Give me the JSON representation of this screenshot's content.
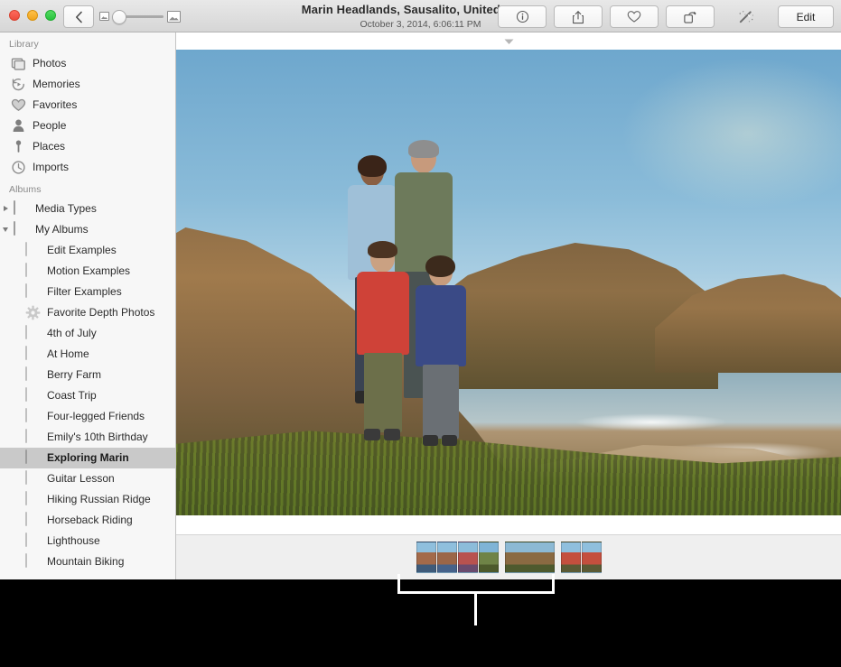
{
  "window": {
    "title": "Marin Headlands, Sausalito, United States",
    "subtitle": "October 3, 2014, 6:06:11 PM"
  },
  "traffic_lights": {
    "close_label": "Close",
    "minimize_label": "Minimize",
    "zoom_label": "Zoom",
    "close_color": "#ec4b3c",
    "minimize_color": "#f0a41c",
    "zoom_color": "#27c33c"
  },
  "toolbar": {
    "back_label": "Back",
    "zoom_slider": {
      "min_icon": "small-photo-icon",
      "max_icon": "large-photo-icon",
      "value": 0
    },
    "buttons": [
      {
        "name": "info-button",
        "icon": "info-icon",
        "label": ""
      },
      {
        "name": "share-button",
        "icon": "share-icon",
        "label": ""
      },
      {
        "name": "favorite-button",
        "icon": "heart-icon",
        "label": ""
      },
      {
        "name": "rotate-button",
        "icon": "rotate-icon",
        "label": ""
      },
      {
        "name": "auto-enhance-button",
        "icon": "magic-wand-icon",
        "label": ""
      }
    ],
    "edit_label": "Edit"
  },
  "sidebar": {
    "sections": [
      {
        "header": "Library",
        "items": [
          {
            "label": "Photos",
            "icon": "photos-icon",
            "kind": "glyph"
          },
          {
            "label": "Memories",
            "icon": "memories-icon",
            "kind": "glyph"
          },
          {
            "label": "Favorites",
            "icon": "heart-icon",
            "kind": "glyph"
          },
          {
            "label": "People",
            "icon": "person-icon",
            "kind": "glyph"
          },
          {
            "label": "Places",
            "icon": "map-pin-icon",
            "kind": "glyph"
          },
          {
            "label": "Imports",
            "icon": "clock-icon",
            "kind": "glyph"
          }
        ]
      },
      {
        "header": "Albums",
        "items": [
          {
            "label": "Media Types",
            "icon": "folder-icon",
            "kind": "folder",
            "disclosure": "closed"
          },
          {
            "label": "My Albums",
            "icon": "folder-icon",
            "kind": "folder",
            "disclosure": "open"
          },
          {
            "label": "Edit Examples",
            "icon": "album-thumbnail",
            "kind": "thumb",
            "indent": true,
            "colors": [
              "#7fa9c9",
              "#8b7050",
              "#55493a"
            ]
          },
          {
            "label": "Motion Examples",
            "icon": "album-thumbnail",
            "kind": "thumb",
            "indent": true,
            "colors": [
              "#f5a623",
              "#f08c14",
              "#c96f0c"
            ]
          },
          {
            "label": "Filter Examples",
            "icon": "album-thumbnail",
            "kind": "thumb",
            "indent": true,
            "colors": [
              "#7b8a4e",
              "#5a6b34",
              "#3f4d24"
            ]
          },
          {
            "label": "Favorite Depth Photos",
            "icon": "gear-icon",
            "kind": "gear",
            "indent": true
          },
          {
            "label": "4th of July",
            "icon": "album-thumbnail",
            "kind": "thumb",
            "indent": true,
            "colors": [
              "#9fb6cf",
              "#c96b6b",
              "#5a6e8e"
            ]
          },
          {
            "label": "At Home",
            "icon": "album-thumbnail",
            "kind": "thumb",
            "indent": true,
            "colors": [
              "#e4ddd2",
              "#b0474a",
              "#6d7d9b"
            ]
          },
          {
            "label": "Berry Farm",
            "icon": "album-thumbnail",
            "kind": "thumb",
            "indent": true,
            "colors": [
              "#6f9fc4",
              "#c7562c",
              "#8e6a3a"
            ]
          },
          {
            "label": "Coast Trip",
            "icon": "album-thumbnail",
            "kind": "thumb",
            "indent": true,
            "colors": [
              "#8fa55c",
              "#5d7438",
              "#3c4a23"
            ]
          },
          {
            "label": "Four-legged Friends",
            "icon": "album-thumbnail",
            "kind": "thumb",
            "indent": true,
            "colors": [
              "#98ab72",
              "#49612f",
              "#2f3f1e"
            ]
          },
          {
            "label": "Emily's 10th Birthday",
            "icon": "album-thumbnail",
            "kind": "thumb",
            "indent": true,
            "colors": [
              "#d6cfc2",
              "#b8653f",
              "#7b7f6a"
            ]
          },
          {
            "label": "Exploring Marin",
            "icon": "album-thumbnail",
            "kind": "thumb",
            "indent": true,
            "selected": true,
            "colors": [
              "#86b4d4",
              "#a8744a",
              "#5c5b33"
            ]
          },
          {
            "label": "Guitar Lesson",
            "icon": "album-thumbnail",
            "kind": "thumb",
            "indent": true,
            "colors": [
              "#e3c9a1",
              "#c33a33",
              "#8a5a33"
            ]
          },
          {
            "label": "Hiking Russian Ridge",
            "icon": "album-thumbnail",
            "kind": "thumb",
            "indent": true,
            "colors": [
              "#f0d24e",
              "#7e9a4c",
              "#47602c"
            ]
          },
          {
            "label": "Horseback Riding",
            "icon": "album-thumbnail",
            "kind": "thumb",
            "indent": true,
            "colors": [
              "#b7c4cc",
              "#4a3c2f",
              "#2c2a22"
            ]
          },
          {
            "label": "Lighthouse",
            "icon": "album-thumbnail",
            "kind": "thumb",
            "indent": true,
            "colors": [
              "#6fa9d2",
              "#d8d8d2",
              "#8a7a5c"
            ]
          },
          {
            "label": "Mountain Biking",
            "icon": "album-thumbnail",
            "kind": "thumb",
            "indent": true,
            "colors": [
              "#8fa860",
              "#7a4f2e",
              "#47562a"
            ]
          }
        ]
      }
    ]
  },
  "filmstrip": {
    "collapse_indicator": "triangle-down-icon",
    "groups": [
      {
        "thumbs": [
          {
            "colors": [
              "#8fbfdd",
              "#a36a4a",
              "#3f5b7a"
            ]
          },
          {
            "colors": [
              "#8fbfdd",
              "#9b6648",
              "#46628a"
            ]
          },
          {
            "colors": [
              "#8cbcda",
              "#b8524f",
              "#6a4b6e"
            ]
          },
          {
            "colors": [
              "#7fb4d6",
              "#6f8347",
              "#4d5a2c"
            ]
          }
        ]
      },
      {
        "thumbs": [
          {
            "wide": true,
            "colors": [
              "#8cb9d4",
              "#8a6a42",
              "#4e5a2e"
            ]
          }
        ]
      },
      {
        "thumbs": [
          {
            "colors": [
              "#8fbfdd",
              "#c44f3e",
              "#5b5a35"
            ]
          },
          {
            "colors": [
              "#8fbfdd",
              "#c44f3e",
              "#5b5a35"
            ]
          }
        ]
      }
    ]
  },
  "annotation": {
    "callout_name": "filmstrip-callout-bracket",
    "callout_color": "#ffffff"
  },
  "photo": {
    "alt": "Family of four standing on a coastal hillside at Marin Headlands with ocean and cliffs behind"
  }
}
